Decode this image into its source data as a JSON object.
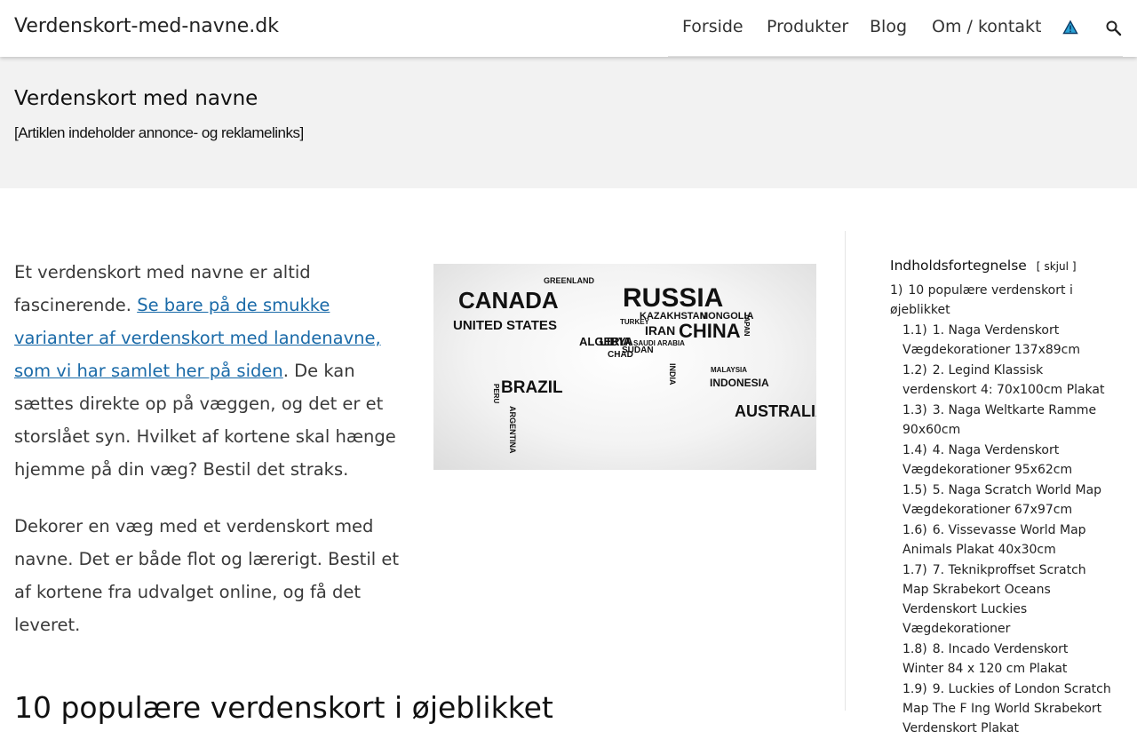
{
  "header": {
    "site_title": "Verdenskort-med-navne.dk",
    "nav": [
      "Forside",
      "Produkter",
      "Blog",
      "Om / kontakt"
    ],
    "icons": [
      "warning-icon",
      "search-icon"
    ],
    "accent_color": "#29a3d6"
  },
  "hero": {
    "title": "Verdenskort med navne",
    "disclaimer": "[Artiklen indeholder annonce- og reklamelinks]"
  },
  "content": {
    "para1_before": "Et verdenskort med navne er altid fascinerende. ",
    "para1_link": "Se bare på de smukke varianter af verdenskort med landenavne, som vi har samlet her på siden",
    "para1_after": ". De kan sættes direkte op på væggen, og det er et storslået syn. Hvilket af kortene skal hænge hjemme på din væg? Bestil det straks.",
    "para2": "Dekorer en væg med et verdenskort med navne. Det er både flot og lærerigt. Bestil et af kortene fra udvalget online, og få det leveret.",
    "heading": "10 populære verdenskort i øjeblikket",
    "image_words": [
      "CANADA",
      "UNITED STATES",
      "GREENLAND",
      "RUSSIA",
      "KAZAKHSTAN",
      "MONGOLIA",
      "CHINA",
      "INDIA",
      "BRAZIL",
      "ARGENTINA",
      "PERU",
      "ALGERIA",
      "LIBYA",
      "CHAD",
      "SUDAN",
      "IRAN",
      "TURKEY",
      "JAPAN",
      "INDONESIA",
      "AUSTRALIA",
      "MALAYSIA",
      "SAUDI ARABIA"
    ],
    "link_color": "#1a6aa8"
  },
  "toc": {
    "title": "Indholdsfortegnelse",
    "toggle_open": "[",
    "toggle_label": "skjul",
    "toggle_close": "]",
    "items": [
      {
        "num": "1)",
        "text": "10 populære verdenskort i øjeblikket",
        "level": 1
      },
      {
        "num": "1.1)",
        "text": "1. Naga Verdenskort Vægdekorationer 137x89cm",
        "level": 2
      },
      {
        "num": "1.2)",
        "text": "2. Legind Klassisk verdenskort 4: 70x100cm Plakat",
        "level": 2
      },
      {
        "num": "1.3)",
        "text": "3. Naga Weltkarte Ramme 90x60cm",
        "level": 2
      },
      {
        "num": "1.4)",
        "text": "4. Naga Verdenskort Vægdekorationer 95x62cm",
        "level": 2
      },
      {
        "num": "1.5)",
        "text": "5. Naga Scratch World Map Vægdekorationer 67x97cm",
        "level": 2
      },
      {
        "num": "1.6)",
        "text": "6. Vissevasse World Map Animals Plakat 40x30cm",
        "level": 2
      },
      {
        "num": "1.7)",
        "text": "7. Teknikproffset Scratch Map Skrabekort Oceans Verdenskort Luckies Vægdekorationer",
        "level": 2
      },
      {
        "num": "1.8)",
        "text": "8. Incado Verdenskort Winter 84 x 120 cm Plakat",
        "level": 2
      },
      {
        "num": "1.9)",
        "text": "9. Luckies of London Scratch Map The F Ing World Skrabekort Verdenskort Plakat",
        "level": 2
      }
    ]
  }
}
